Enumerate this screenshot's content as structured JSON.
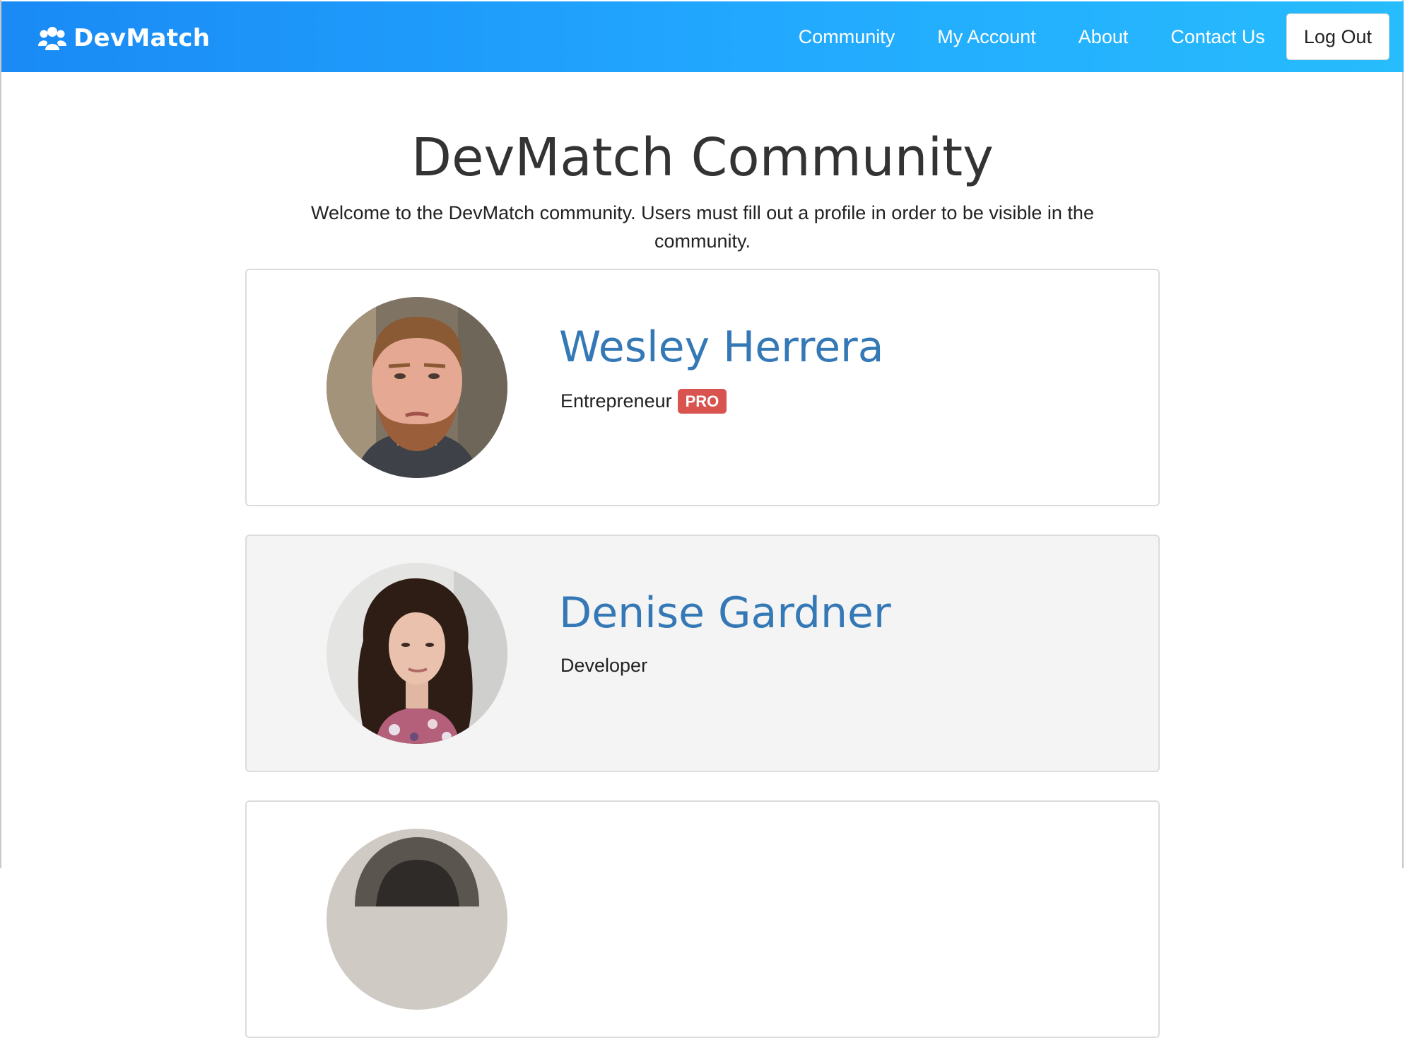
{
  "navbar": {
    "brand": "DevMatch",
    "brand_icon": "users-icon",
    "links": [
      "Community",
      "My Account",
      "About",
      "Contact Us"
    ],
    "logout_label": "Log Out",
    "gradient_start": "#1a8af5",
    "gradient_end": "#27bcfc"
  },
  "header": {
    "title": "DevMatch Community",
    "intro": "Welcome to the DevMatch community. Users must fill out a profile in order to be visible in the community."
  },
  "members": [
    {
      "name": "Wesley Herrera",
      "role": "Entrepreneur",
      "badge": "PRO"
    },
    {
      "name": "Denise Gardner",
      "role": "Developer",
      "badge": ""
    },
    {
      "name": "",
      "role": "",
      "badge": ""
    }
  ],
  "colors": {
    "name_link": "#3478b6",
    "pro_badge": "#d9534f",
    "card_border": "#dcdcdc",
    "alt_card_bg": "#f4f4f4"
  }
}
